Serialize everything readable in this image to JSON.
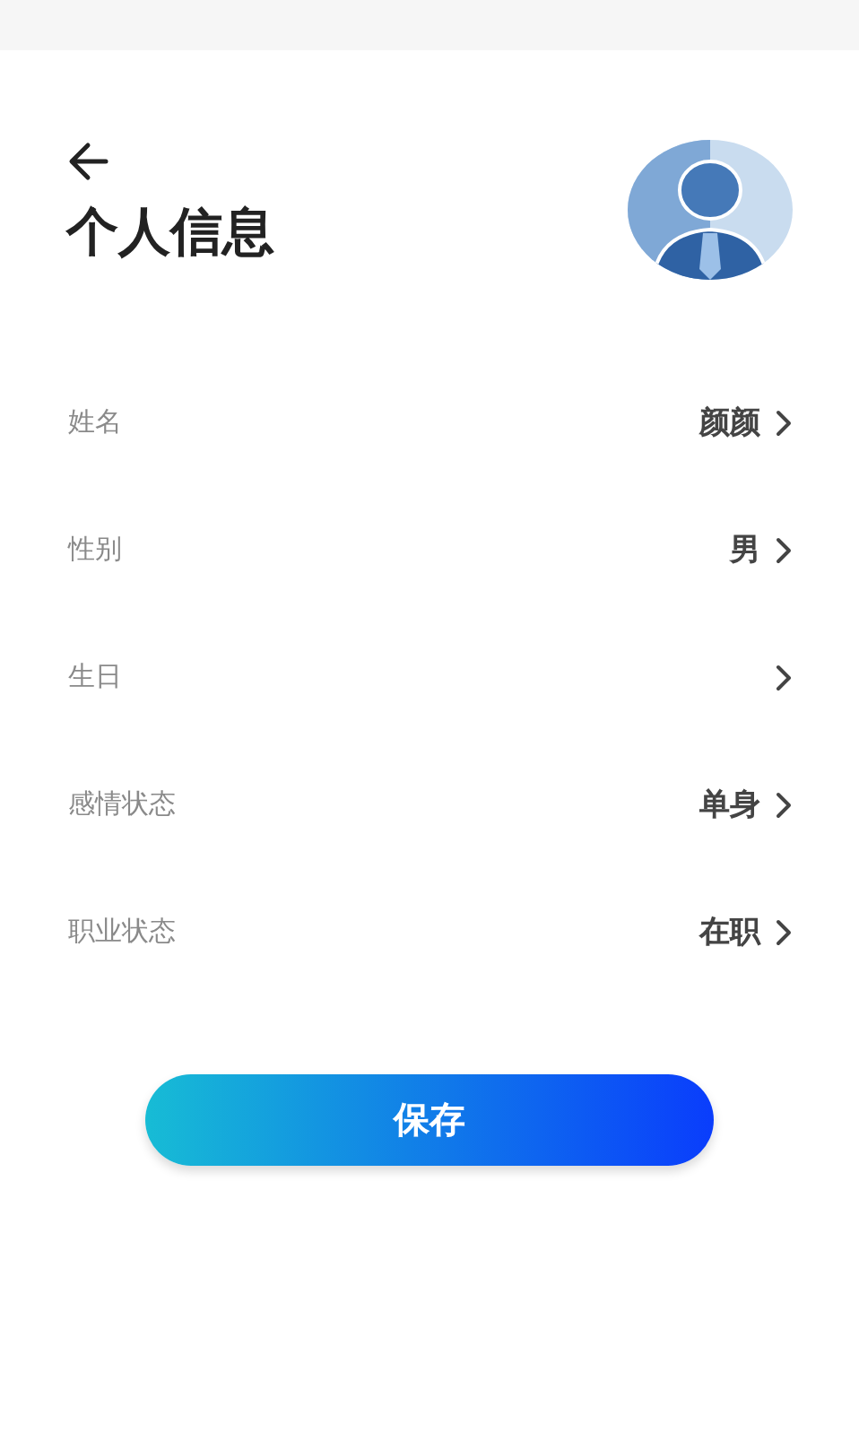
{
  "title": "个人信息",
  "fields": [
    {
      "label": "姓名",
      "value": "颜颜"
    },
    {
      "label": "性别",
      "value": "男"
    },
    {
      "label": "生日"
    },
    {
      "label": "感情状态",
      "value": "单身"
    },
    {
      "label": "职业状态",
      "value": "在职"
    }
  ],
  "save_button": "保存"
}
